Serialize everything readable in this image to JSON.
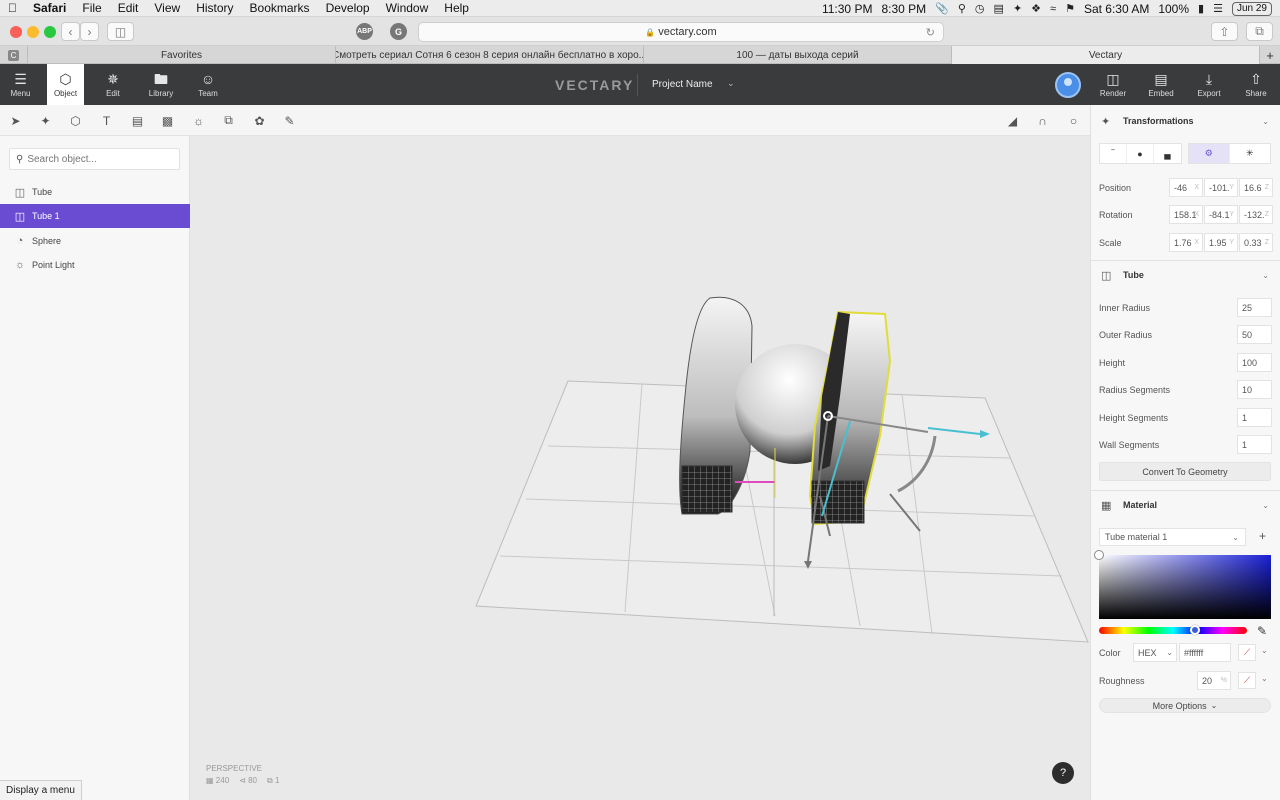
{
  "menubar": {
    "apple": "",
    "app": "Safari",
    "items": [
      "File",
      "Edit",
      "View",
      "History",
      "Bookmarks",
      "Develop",
      "Window",
      "Help"
    ],
    "clock1": "11:30 PM",
    "clock2": "8:30 PM",
    "datetime": "Sat 6:30 AM",
    "battery": "100%",
    "date_badge": "Jun 29"
  },
  "safari": {
    "url": "vectary.com",
    "ext1": "ABP",
    "ext2": "G"
  },
  "tabs": [
    {
      "label": "Favorites"
    },
    {
      "label": "Смотреть сериал Сотня 6 сезон 8 серия онлайн бесплатно в хоро..."
    },
    {
      "label": "100 — даты выхода серий"
    },
    {
      "label": "Vectary"
    }
  ],
  "header": {
    "menu": "Menu",
    "object": "Object",
    "edit": "Edit",
    "library": "Library",
    "team": "Team",
    "logo": "VECTARY",
    "project_name": "Project Name",
    "render": "Render",
    "embed": "Embed",
    "export": "Export",
    "share": "Share"
  },
  "search": {
    "placeholder": "Search object..."
  },
  "objects": [
    {
      "label": "Tube",
      "icon": "cylinder-icon"
    },
    {
      "label": "Tube 1",
      "icon": "cylinder-icon"
    },
    {
      "label": "Sphere",
      "icon": "sphere-icon"
    },
    {
      "label": "Point Light",
      "icon": "light-icon"
    }
  ],
  "viewport": {
    "camera": "PERSPECTIVE",
    "verts": "240",
    "edges": "80",
    "objects": "1",
    "help": "?"
  },
  "status_tip": "Display a menu",
  "transformations": {
    "title": "Transformations",
    "position_label": "Position",
    "position": [
      "-46",
      "-101.",
      "16.6"
    ],
    "rotation_label": "Rotation",
    "rotation": [
      "158.1",
      "-84.1",
      "-132."
    ],
    "scale_label": "Scale",
    "scale": [
      "1.76",
      "1.95",
      "0.33"
    ],
    "axes": [
      "X",
      "Y",
      "Z"
    ]
  },
  "tube": {
    "title": "Tube",
    "inner_radius_label": "Inner Radius",
    "inner_radius": "25",
    "outer_radius_label": "Outer Radius",
    "outer_radius": "50",
    "height_label": "Height",
    "height": "100",
    "radius_segments_label": "Radius Segments",
    "radius_segments": "10",
    "height_segments_label": "Height Segments",
    "height_segments": "1",
    "wall_segments_label": "Wall Segments",
    "wall_segments": "1",
    "convert_label": "Convert To Geometry"
  },
  "material": {
    "title": "Material",
    "selected": "Tube material 1",
    "color_label": "Color",
    "color_mode": "HEX",
    "hex": "#ffffff",
    "roughness_label": "Roughness",
    "roughness": "20",
    "roughness_unit": "%",
    "more_options": "More Options",
    "hue_fraction": 0.65
  }
}
